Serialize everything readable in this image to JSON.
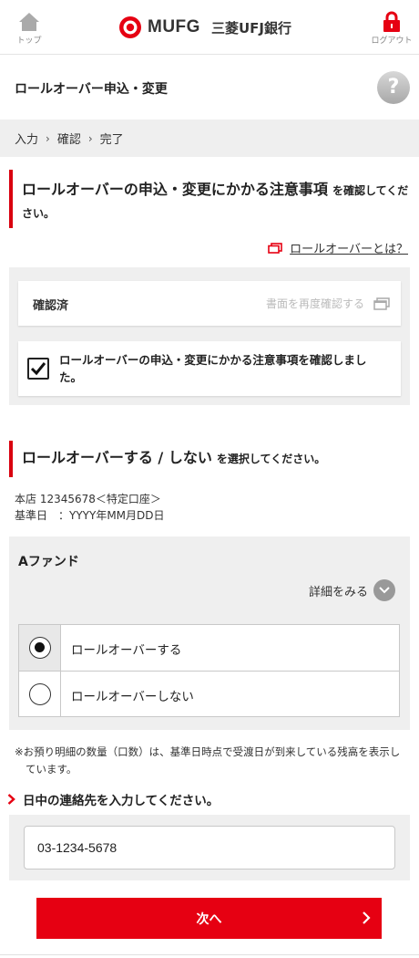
{
  "header": {
    "home_label": "トップ",
    "brand_name": "MUFG",
    "bank_name": "三菱UFJ銀行",
    "logout_label": "ログアウト"
  },
  "page": {
    "title": "ロールオーバー申込・変更",
    "help_glyph": "?"
  },
  "breadcrumb": {
    "steps": [
      "入力",
      "確認",
      "完了"
    ]
  },
  "notice_section": {
    "heading_big": "ロールオーバーの申込・変更にかかる注意事項",
    "heading_small": "を確認してください。",
    "link_label": "ロールオーバーとは？",
    "confirmed_label": "確認済",
    "reread_label": "書面を再度確認する",
    "checkbox_label": "ロールオーバーの申込・変更にかかる注意事項を確認しました。",
    "checkbox_checked": true
  },
  "select_section": {
    "heading_big": "ロールオーバーする / しない",
    "heading_small": "を選択してください。"
  },
  "account": {
    "line1": "本店 12345678＜特定口座＞",
    "line2": "基準日　：YYYY年MM月DD日"
  },
  "fund": {
    "name": "Aファンド",
    "detail_label": "詳細をみる",
    "options": [
      {
        "label": "ロールオーバーする",
        "selected": true
      },
      {
        "label": "ロールオーバーしない",
        "selected": false
      }
    ]
  },
  "note": "※お預り明細の数量（口数）は、基準日時点で受渡日が到来している残高を表示しています。",
  "contact": {
    "heading": "日中の連絡先を入力してください。",
    "phone_value": "03-1234-5678"
  },
  "actions": {
    "next_label": "次へ"
  },
  "colors": {
    "accent_red": "#e60012",
    "panel_grey": "#efefef"
  }
}
